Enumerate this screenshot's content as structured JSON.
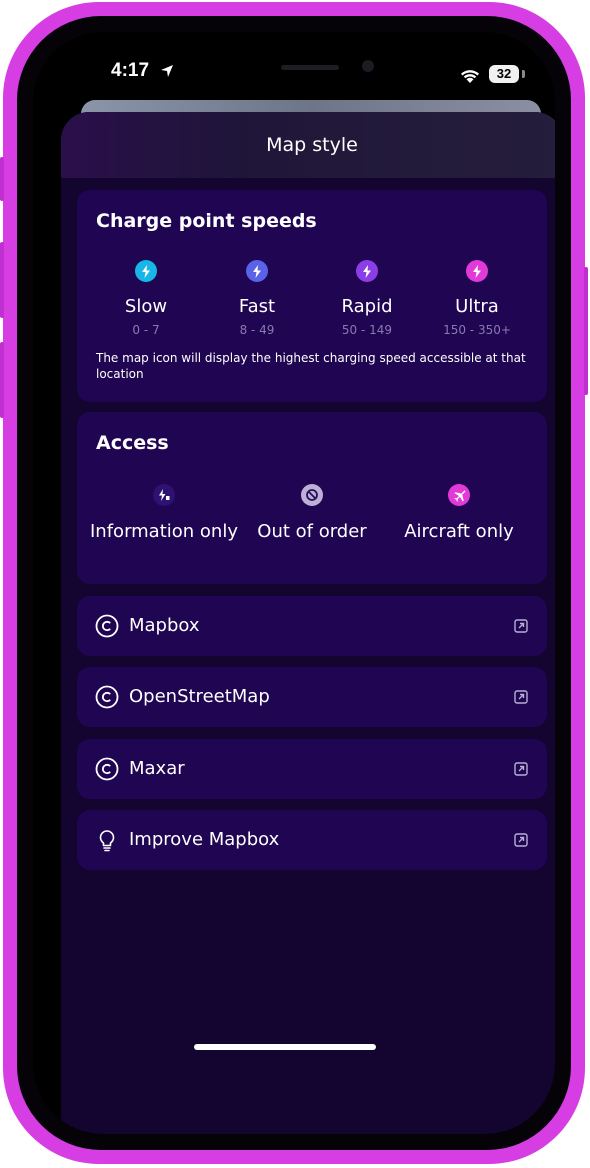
{
  "status_bar": {
    "time": "4:17",
    "battery": "32"
  },
  "sheet": {
    "title": "Map style"
  },
  "charge_speeds": {
    "title": "Charge point speeds",
    "items": [
      {
        "label": "Slow",
        "range": "0 - 7",
        "icon": "bolt-icon",
        "color": "#17b6e6"
      },
      {
        "label": "Fast",
        "range": "8 - 49",
        "icon": "bolt-icon",
        "color": "#5a62e8"
      },
      {
        "label": "Rapid",
        "range": "50 - 149",
        "icon": "bolt-icon",
        "color": "#8b3ee6"
      },
      {
        "label": "Ultra",
        "range": "150 - 350+",
        "icon": "bolt-icon",
        "color": "#e23ad9"
      }
    ],
    "note": "The map icon will display the highest charging speed accessible at that location"
  },
  "access": {
    "title": "Access",
    "items": [
      {
        "label": "Information only",
        "icon": "info-bolt-icon"
      },
      {
        "label": "Out of order",
        "icon": "prohibited-icon"
      },
      {
        "label": "Aircraft only",
        "icon": "airplane-icon"
      }
    ]
  },
  "links": [
    {
      "label": "Mapbox",
      "icon": "copyright-icon"
    },
    {
      "label": "OpenStreetMap",
      "icon": "copyright-icon"
    },
    {
      "label": "Maxar",
      "icon": "copyright-icon"
    },
    {
      "label": "Improve Mapbox",
      "icon": "lightbulb-icon"
    }
  ]
}
